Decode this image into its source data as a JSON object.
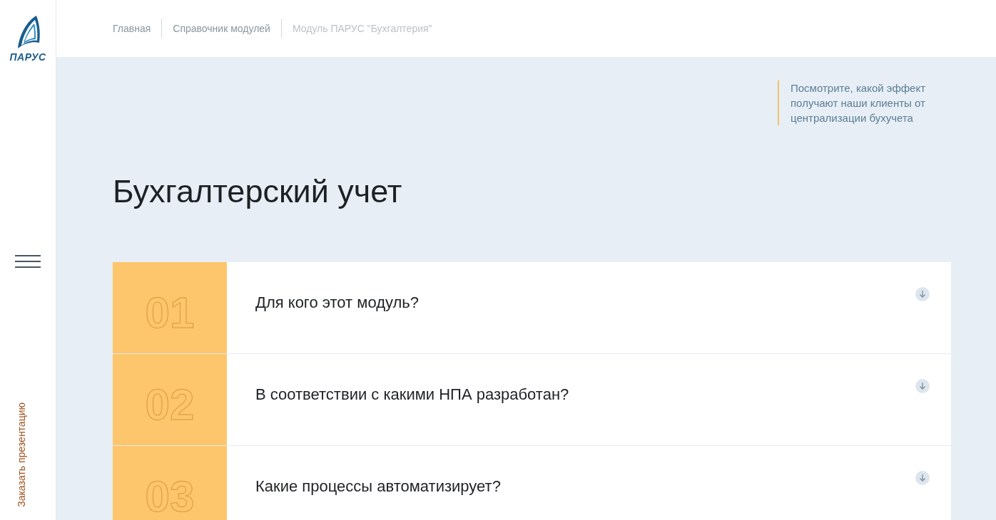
{
  "logo": {
    "text": "ПАРУС"
  },
  "sidebar": {
    "cta": "Заказать презентацию"
  },
  "breadcrumbs": [
    {
      "label": "Главная",
      "current": false
    },
    {
      "label": "Справочник модулей",
      "current": false
    },
    {
      "label": "Модуль ПАРУС \"Бухгалтерия\"",
      "current": true
    }
  ],
  "callout": "Посмотрите, какой эффект получают наши клиенты от централизации бухучета",
  "title": "Бухгалтерский учет",
  "accordion": [
    {
      "number": "01",
      "question": "Для кого этот модуль?",
      "expanded": false
    },
    {
      "number": "02",
      "question": "В соответствии с какими НПА разработан?",
      "expanded": false
    },
    {
      "number": "03",
      "question": "Какие процессы автоматизирует?",
      "expanded": false
    }
  ]
}
